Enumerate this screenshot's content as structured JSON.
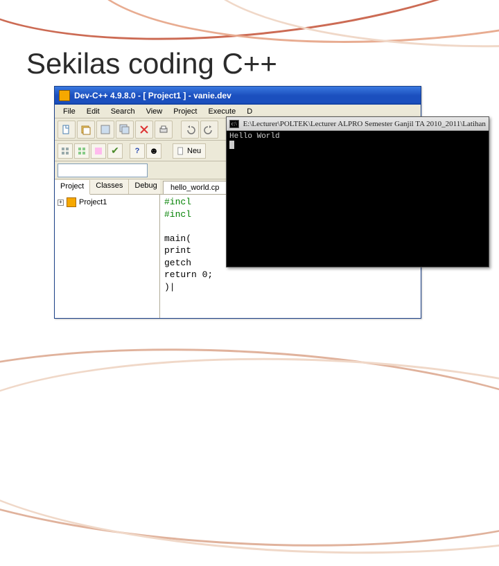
{
  "slide": {
    "title": "Sekilas coding C++"
  },
  "ide": {
    "title": "Dev-C++ 4.9.8.0   -   [ Project1 ] - vanie.dev",
    "menus": [
      "File",
      "Edit",
      "Search",
      "View",
      "Project",
      "Execute",
      "D"
    ],
    "neu_label": "Neu",
    "side_tabs": {
      "project": "Project",
      "classes": "Classes",
      "debug": "Debug"
    },
    "tree_item": "Project1",
    "editor_tab": "hello_world.cp",
    "code": {
      "l1": "#incl",
      "l2": "#incl",
      "l3": "",
      "l4": "main(",
      "l5": "print",
      "l6": "getch",
      "l7": "return 0;",
      "l8": ")|"
    }
  },
  "console": {
    "title": "E:\\Lecturer\\POLTEK\\Lecturer ALPRO Semester Ganjil TA 2010_2011\\Latihan cp",
    "output": "Hello World"
  }
}
